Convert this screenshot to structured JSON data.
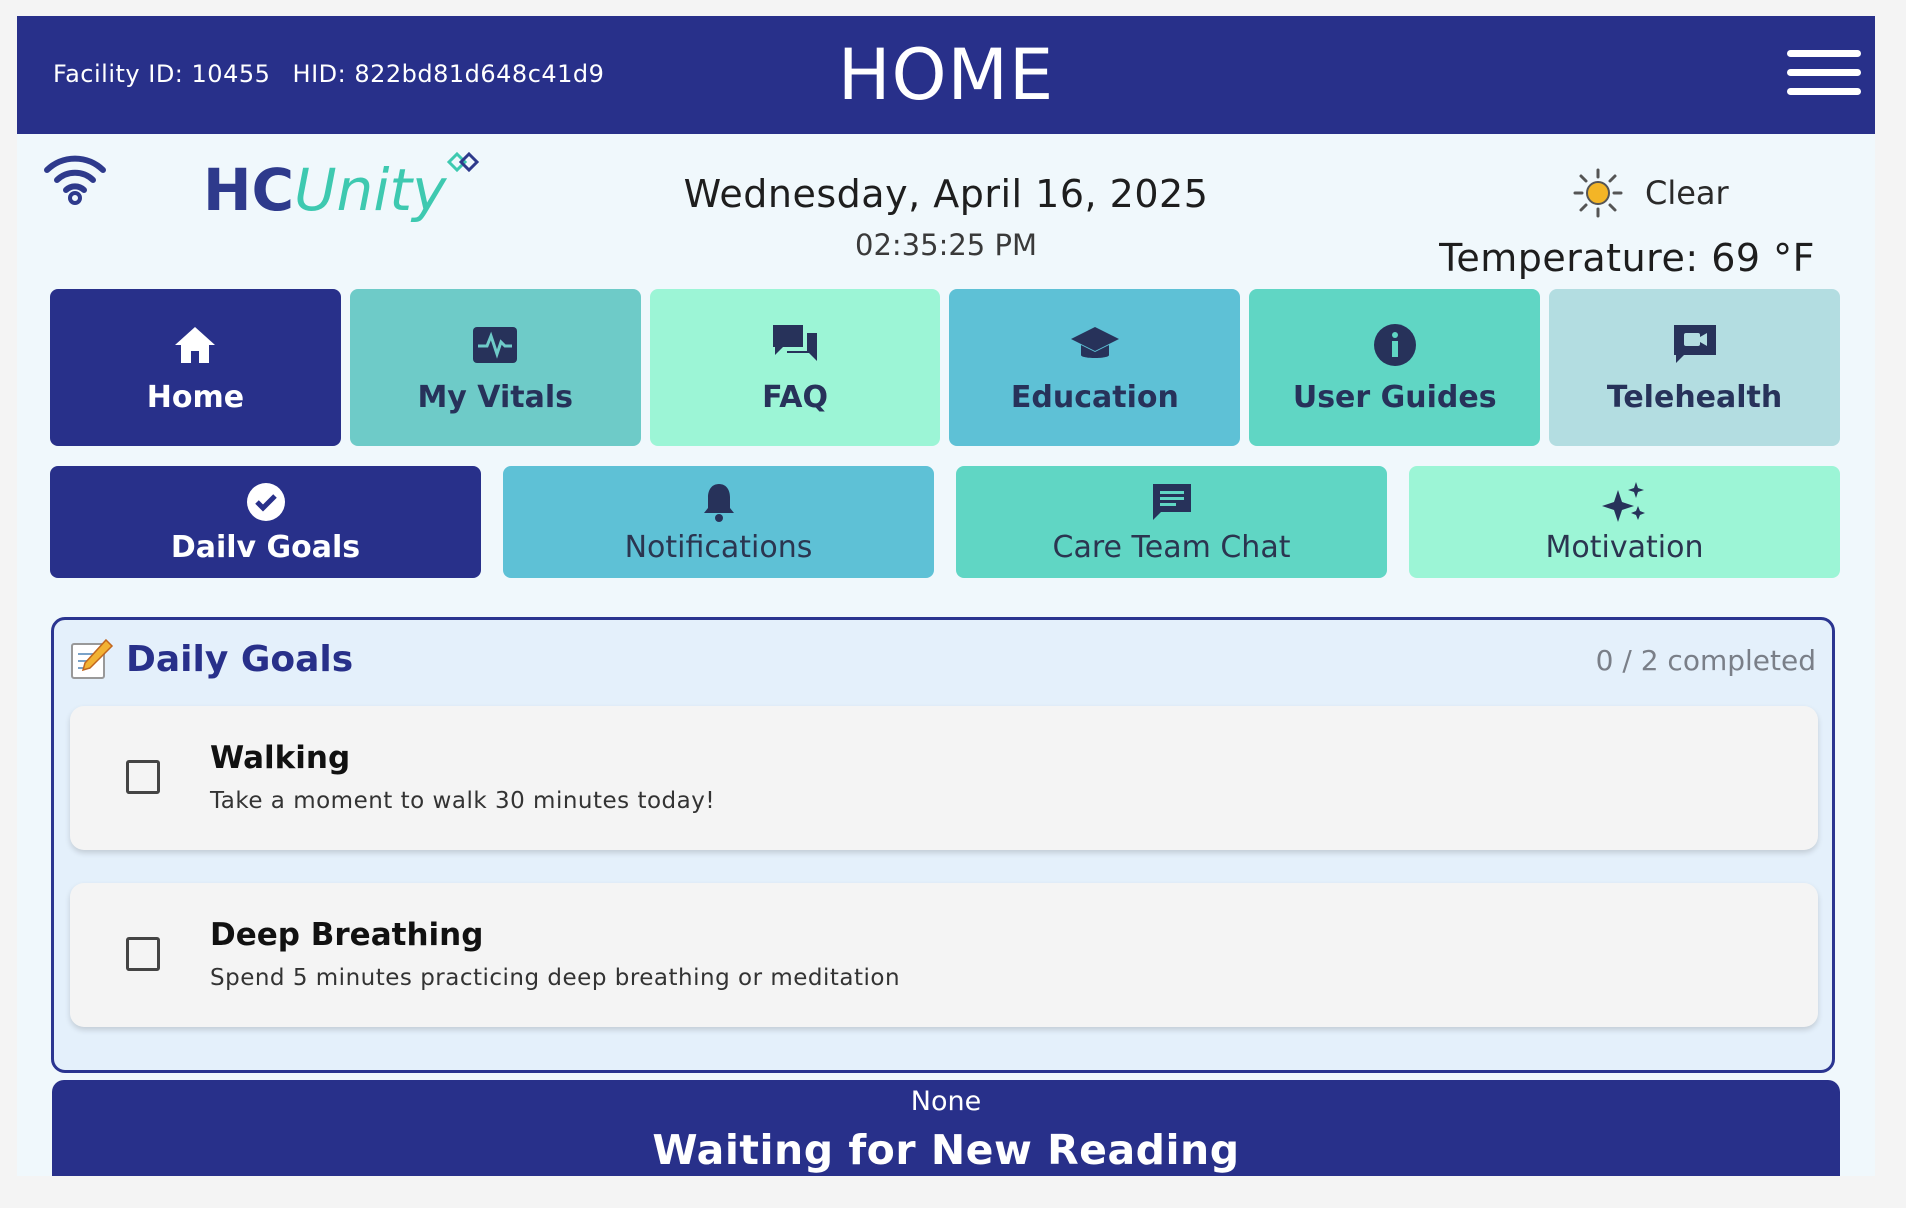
{
  "header": {
    "facility_id": "Facility ID: 10455",
    "hid": "HID: 822bd81d648c41d9",
    "title": "HOME"
  },
  "logo": {
    "part1": "HC",
    "part2": "Unity"
  },
  "datetime": {
    "date": "Wednesday, April 16, 2025",
    "time": "02:35:25 PM"
  },
  "weather": {
    "icon": "sun-icon",
    "condition": "Clear",
    "temperature": "Temperature: 69 °F"
  },
  "nav_primary": [
    {
      "label": "Home",
      "icon": "home-icon",
      "color": "#28308a",
      "active": true
    },
    {
      "label": "My Vitals",
      "icon": "vitals-icon",
      "color": "#6ecbc8"
    },
    {
      "label": "FAQ",
      "icon": "faq-icon",
      "color": "#9cf5d6"
    },
    {
      "label": "Education",
      "icon": "education-icon",
      "color": "#5ec1d6"
    },
    {
      "label": "User Guides",
      "icon": "info-icon",
      "color": "#60d6c4"
    },
    {
      "label": "Telehealth",
      "icon": "telehealth-icon",
      "color": "#b3dde1"
    }
  ],
  "nav_secondary": [
    {
      "label": "Dailv Goals",
      "icon": "check-circle-icon",
      "color": "#28308a",
      "active": true
    },
    {
      "label": "Notifications",
      "icon": "bell-icon",
      "color": "#5ec1d6"
    },
    {
      "label": "Care Team Chat",
      "icon": "chat-icon",
      "color": "#60d6c4"
    },
    {
      "label": "Motivation",
      "icon": "sparkle-icon",
      "color": "#9cf5d6"
    }
  ],
  "goals": {
    "title": "Daily Goals",
    "progress": "0 / 2 completed",
    "items": [
      {
        "title": "Walking",
        "description": "Take a moment to walk 30 minutes today!",
        "checked": false
      },
      {
        "title": "Deep Breathing",
        "description": "Spend 5 minutes practicing deep breathing or meditation",
        "checked": false
      }
    ]
  },
  "reading": {
    "label": "None",
    "status": "Waiting for New Reading"
  }
}
